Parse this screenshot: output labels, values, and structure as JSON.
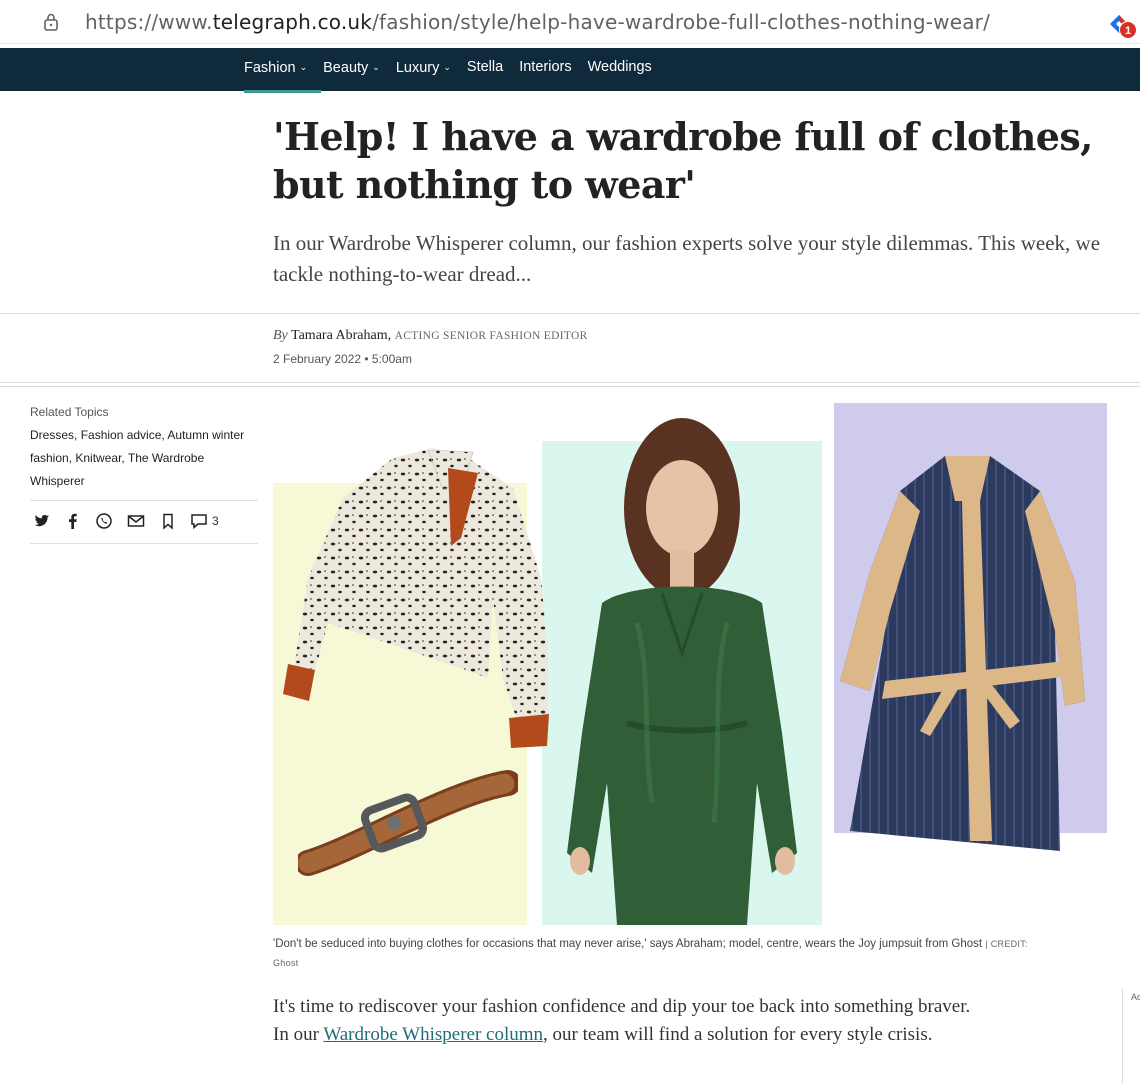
{
  "browser": {
    "url_prefix": "https://www.",
    "url_host": "telegraph.co.uk",
    "url_path": "/fashion/style/help-have-wardrobe-full-clothes-nothing-wear/",
    "extension_badge": "1"
  },
  "nav": {
    "items": [
      {
        "label": "Fashion",
        "chevron": "⌄"
      },
      {
        "label": "Beauty",
        "chevron": "⌄"
      },
      {
        "label": "Luxury",
        "chevron": "⌄"
      },
      {
        "label": "Stella",
        "chevron": ""
      },
      {
        "label": "Interiors",
        "chevron": ""
      },
      {
        "label": "Weddings",
        "chevron": ""
      }
    ],
    "active_color": "#3d9a95",
    "bg_color": "#0f2a3a"
  },
  "article": {
    "headline": "'Help! I have a wardrobe full of clothes, but nothing to wear'",
    "standfirst": "In our Wardrobe Whisperer column, our fashion experts solve your style dilemmas. This week, we tackle nothing-to-wear dread...",
    "by": "By",
    "author": "Tamara Abraham,",
    "role": "ACTING SENIOR FASHION EDITOR",
    "date": "2 February 2022 • 5:00am",
    "caption": "'Don't be seduced into buying clothes for occasions that may never arise,' says Abraham; model, centre, wears the Joy jumpsuit from Ghost",
    "credit_label": "| CREDIT:",
    "credit_value": "Ghost",
    "body_start": "It's time to rediscover your fashion confidence and dip your toe back into something braver. In our",
    "body_link": "Wardrobe Whisperer column",
    "body_end": ", our team will find a solution for every style crisis."
  },
  "sidebar": {
    "topics_title": "Related Topics",
    "topics": [
      "Dresses",
      "Fashion advice",
      "Autumn winter fashion",
      "Knitwear",
      "The Wardrobe Whisperer"
    ],
    "comment_count": "3",
    "share_icons": [
      "twitter-icon",
      "facebook-icon",
      "whatsapp-icon",
      "email-icon",
      "bookmark-icon",
      "comment-icon"
    ]
  },
  "ad_edge_text": "Ac"
}
